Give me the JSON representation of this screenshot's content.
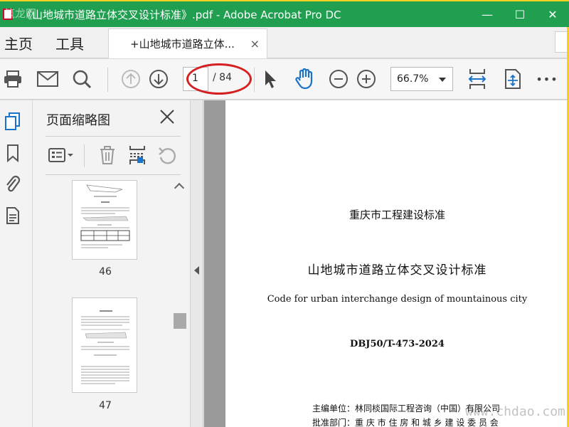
{
  "window": {
    "title": "《山地城市道路立体交叉设计标准》.pdf - Adobe Acrobat Pro DC",
    "minimize": "—",
    "maximize": "☐",
    "close": "✕"
  },
  "menu": {
    "home": "主页",
    "tools": "工具"
  },
  "doc_tab": {
    "label": "+山地城市道路立体...",
    "close": "×"
  },
  "toolbar": {
    "current_page": "1",
    "total_pages": "/ 84",
    "zoom": "66.7%",
    "more": "•••",
    "annotation_color": "#d42020"
  },
  "side_panel": {
    "title": "页面缩略图",
    "thumbnails": [
      {
        "page_label": "46"
      },
      {
        "page_label": "47"
      }
    ]
  },
  "document": {
    "line1": "重庆市工程建设标准",
    "line2": "山地城市道路立体交叉设计标准",
    "line3": "Code for urban interchange design of mountainous city",
    "line4": "DBJ50/T-473-2024",
    "line5": "主编单位：林同棪国际工程咨询（中国）有限公司",
    "line6": "批准部门：重 庆 市 住 房 和 城 乡 建 设 委 员 会"
  },
  "watermarks": {
    "top_left": "筑龙网",
    "bottom_right": "www.chdao.com"
  },
  "colors": {
    "title_bar": "#1f9f4f",
    "frame": "#f5d11f",
    "accent_blue": "#1a73c8"
  }
}
